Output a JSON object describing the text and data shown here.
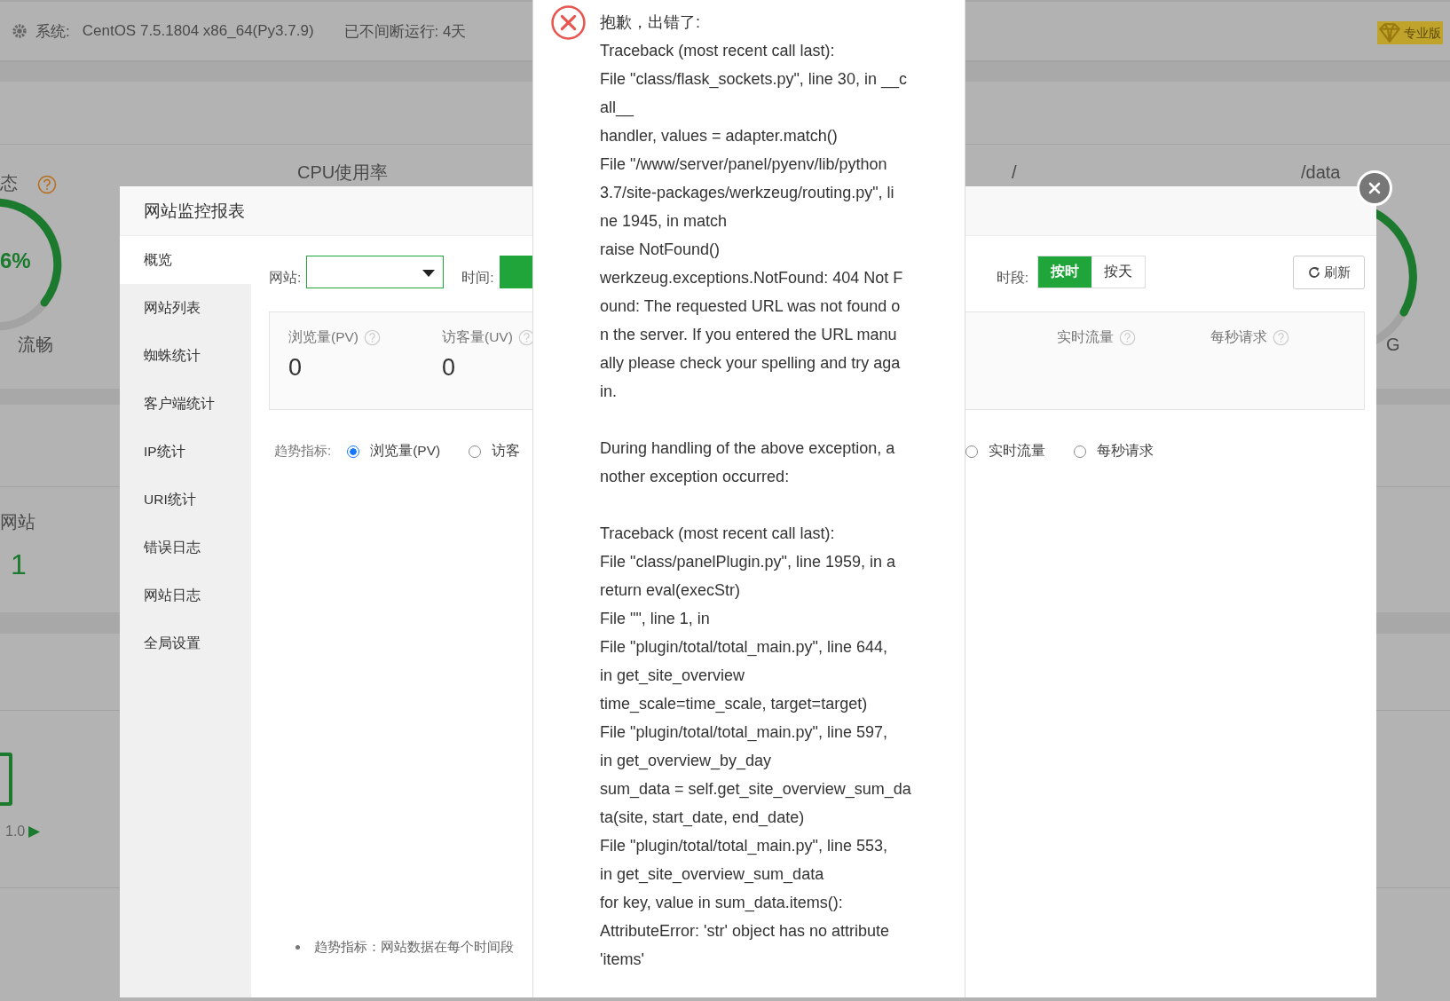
{
  "top_bar": {
    "system_label": "系统:",
    "system_value": "CentOS 7.5.1804 x86_64(Py3.7.9)",
    "uptime": "已不间断运行: 4天",
    "badge": "专业版"
  },
  "background": {
    "status_label": "态",
    "status_value": "6%",
    "status_text": "流畅",
    "cpu_label": "CPU使用率",
    "root_label": "/",
    "data_label": "/data",
    "data_size": "G",
    "sites_label": "网站",
    "sites_count": "1",
    "version": "1.0",
    "version_arrow": "▶"
  },
  "modal": {
    "title": "网站监控报表",
    "sidebar": [
      {
        "label": "概览",
        "selected": true
      },
      {
        "label": "网站列表",
        "selected": false
      },
      {
        "label": "蜘蛛统计",
        "selected": false
      },
      {
        "label": "客户端统计",
        "selected": false
      },
      {
        "label": "IP统计",
        "selected": false
      },
      {
        "label": "URI统计",
        "selected": false
      },
      {
        "label": "错误日志",
        "selected": false
      },
      {
        "label": "网站日志",
        "selected": false
      },
      {
        "label": "全局设置",
        "selected": false
      }
    ],
    "filters": {
      "site_label": "网站:",
      "time_label": "时间:",
      "period_label": "时段:",
      "refresh": "刷新",
      "period_options": [
        {
          "label": "按时",
          "selected": true
        },
        {
          "label": "按天",
          "selected": false
        }
      ]
    },
    "stats": [
      {
        "label": "浏览量(PV)",
        "value": "0"
      },
      {
        "label": "访客量(UV)",
        "value": "0"
      },
      {
        "label": "实时流量"
      },
      {
        "label": "每秒请求"
      }
    ],
    "trend": {
      "label": "趋势指标:",
      "options": [
        {
          "label": "浏览量(PV)",
          "selected": true
        },
        {
          "label": "访客",
          "selected": false
        },
        {
          "label": "实时流量",
          "selected": false
        },
        {
          "label": "每秒请求",
          "selected": false
        }
      ]
    },
    "note": "趋势指标：网站数据在每个时间段"
  },
  "error_popup": {
    "title": "抱歉，出错了:",
    "blocks": [
      [
        "Traceback (most recent call last):",
        "File \"class/flask_sockets.py\", line 30, in __c",
        "all__",
        "handler, values = adapter.match()",
        "File \"/www/server/panel/pyenv/lib/python",
        "3.7/site-packages/werkzeug/routing.py\", li",
        "ne 1945, in match",
        "raise NotFound()",
        "werkzeug.exceptions.NotFound: 404 Not F",
        "ound: The requested URL was not found o",
        "n the server. If you entered the URL manu",
        "ally please check your spelling and try aga",
        "in."
      ],
      [
        "During handling of the above exception, a",
        "nother exception occurred:"
      ],
      [
        "Traceback (most recent call last):",
        "File \"class/panelPlugin.py\", line 1959, in a",
        "return eval(execStr)",
        "File \"\", line 1, in",
        "File \"plugin/total/total_main.py\", line 644,",
        "in get_site_overview",
        "time_scale=time_scale, target=target)",
        "File \"plugin/total/total_main.py\", line 597,",
        "in get_overview_by_day",
        "sum_data = self.get_site_overview_sum_da",
        "ta(site, start_date, end_date)",
        "File \"plugin/total/total_main.py\", line 553,",
        "in get_site_overview_sum_data",
        "for key, value in sum_data.items():",
        "AttributeError: 'str' object has no attribute",
        "'items'"
      ]
    ]
  }
}
